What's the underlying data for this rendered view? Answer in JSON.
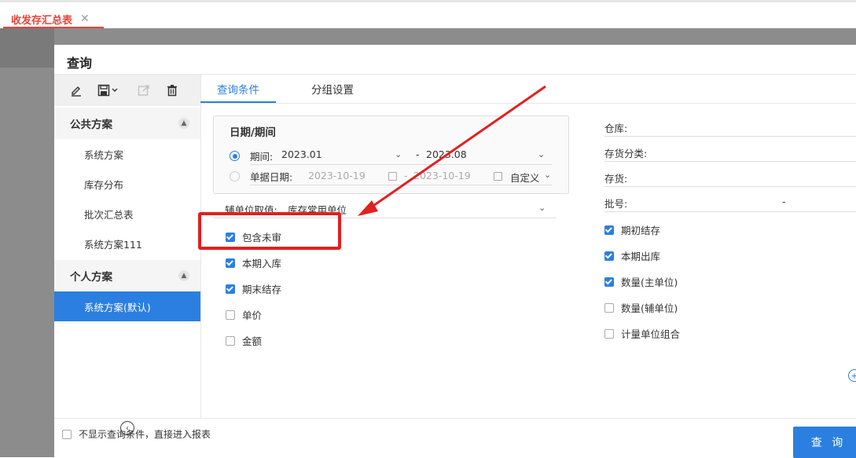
{
  "top_tab": {
    "label": "收发存汇总表",
    "close": "✕"
  },
  "dialog": {
    "title": "查询",
    "sidebar": {
      "toolbar": [
        "edit-icon",
        "save-icon",
        "export-icon",
        "delete-icon"
      ],
      "public_group": {
        "label": "公共方案",
        "items": [
          "系统方案",
          "库存分布",
          "批次汇总表",
          "系统方案111"
        ]
      },
      "personal_group": {
        "label": "个人方案",
        "items": [
          "系统方案(默认)"
        ]
      },
      "collapse": "‹"
    },
    "tabs": [
      "查询条件",
      "分组设置"
    ],
    "date": {
      "title": "日期/期间",
      "period_label": "期间:",
      "period_from": "2023.01",
      "period_sep": "-",
      "period_to": "2023.08",
      "doc_date_label": "单据日期:",
      "doc_date_from": "2023-10-19",
      "doc_date_sep": "-",
      "doc_date_to": "2023-10-19",
      "custom": "自定义"
    },
    "aux_unit": {
      "label": "辅单位取值:",
      "value": "库存常用单位"
    },
    "left_checks": [
      {
        "label": "包含未审",
        "checked": true
      },
      {
        "label": "本期入库",
        "checked": true
      },
      {
        "label": "期末结存",
        "checked": true
      },
      {
        "label": "单价",
        "checked": false
      },
      {
        "label": "金额",
        "checked": false
      }
    ],
    "right_fields": {
      "warehouse": "仓库:",
      "category": "存货分类:",
      "inventory": "存货:",
      "batch": "批号:",
      "batch_sep": "-"
    },
    "right_checks": [
      {
        "label": "期初结存",
        "checked": true
      },
      {
        "label": "本期出库",
        "checked": true
      },
      {
        "label": "数量(主单位)",
        "checked": true
      },
      {
        "label": "数量(辅单位)",
        "checked": false
      },
      {
        "label": "计量单位组合",
        "checked": false
      }
    ],
    "skip_label": "不显示查询条件，直接进入报表",
    "query_button": "查 询",
    "plus": "+"
  },
  "colors": {
    "accent": "#2b7fe0",
    "annotation": "#e22020",
    "tab_active": "#e8423a"
  }
}
